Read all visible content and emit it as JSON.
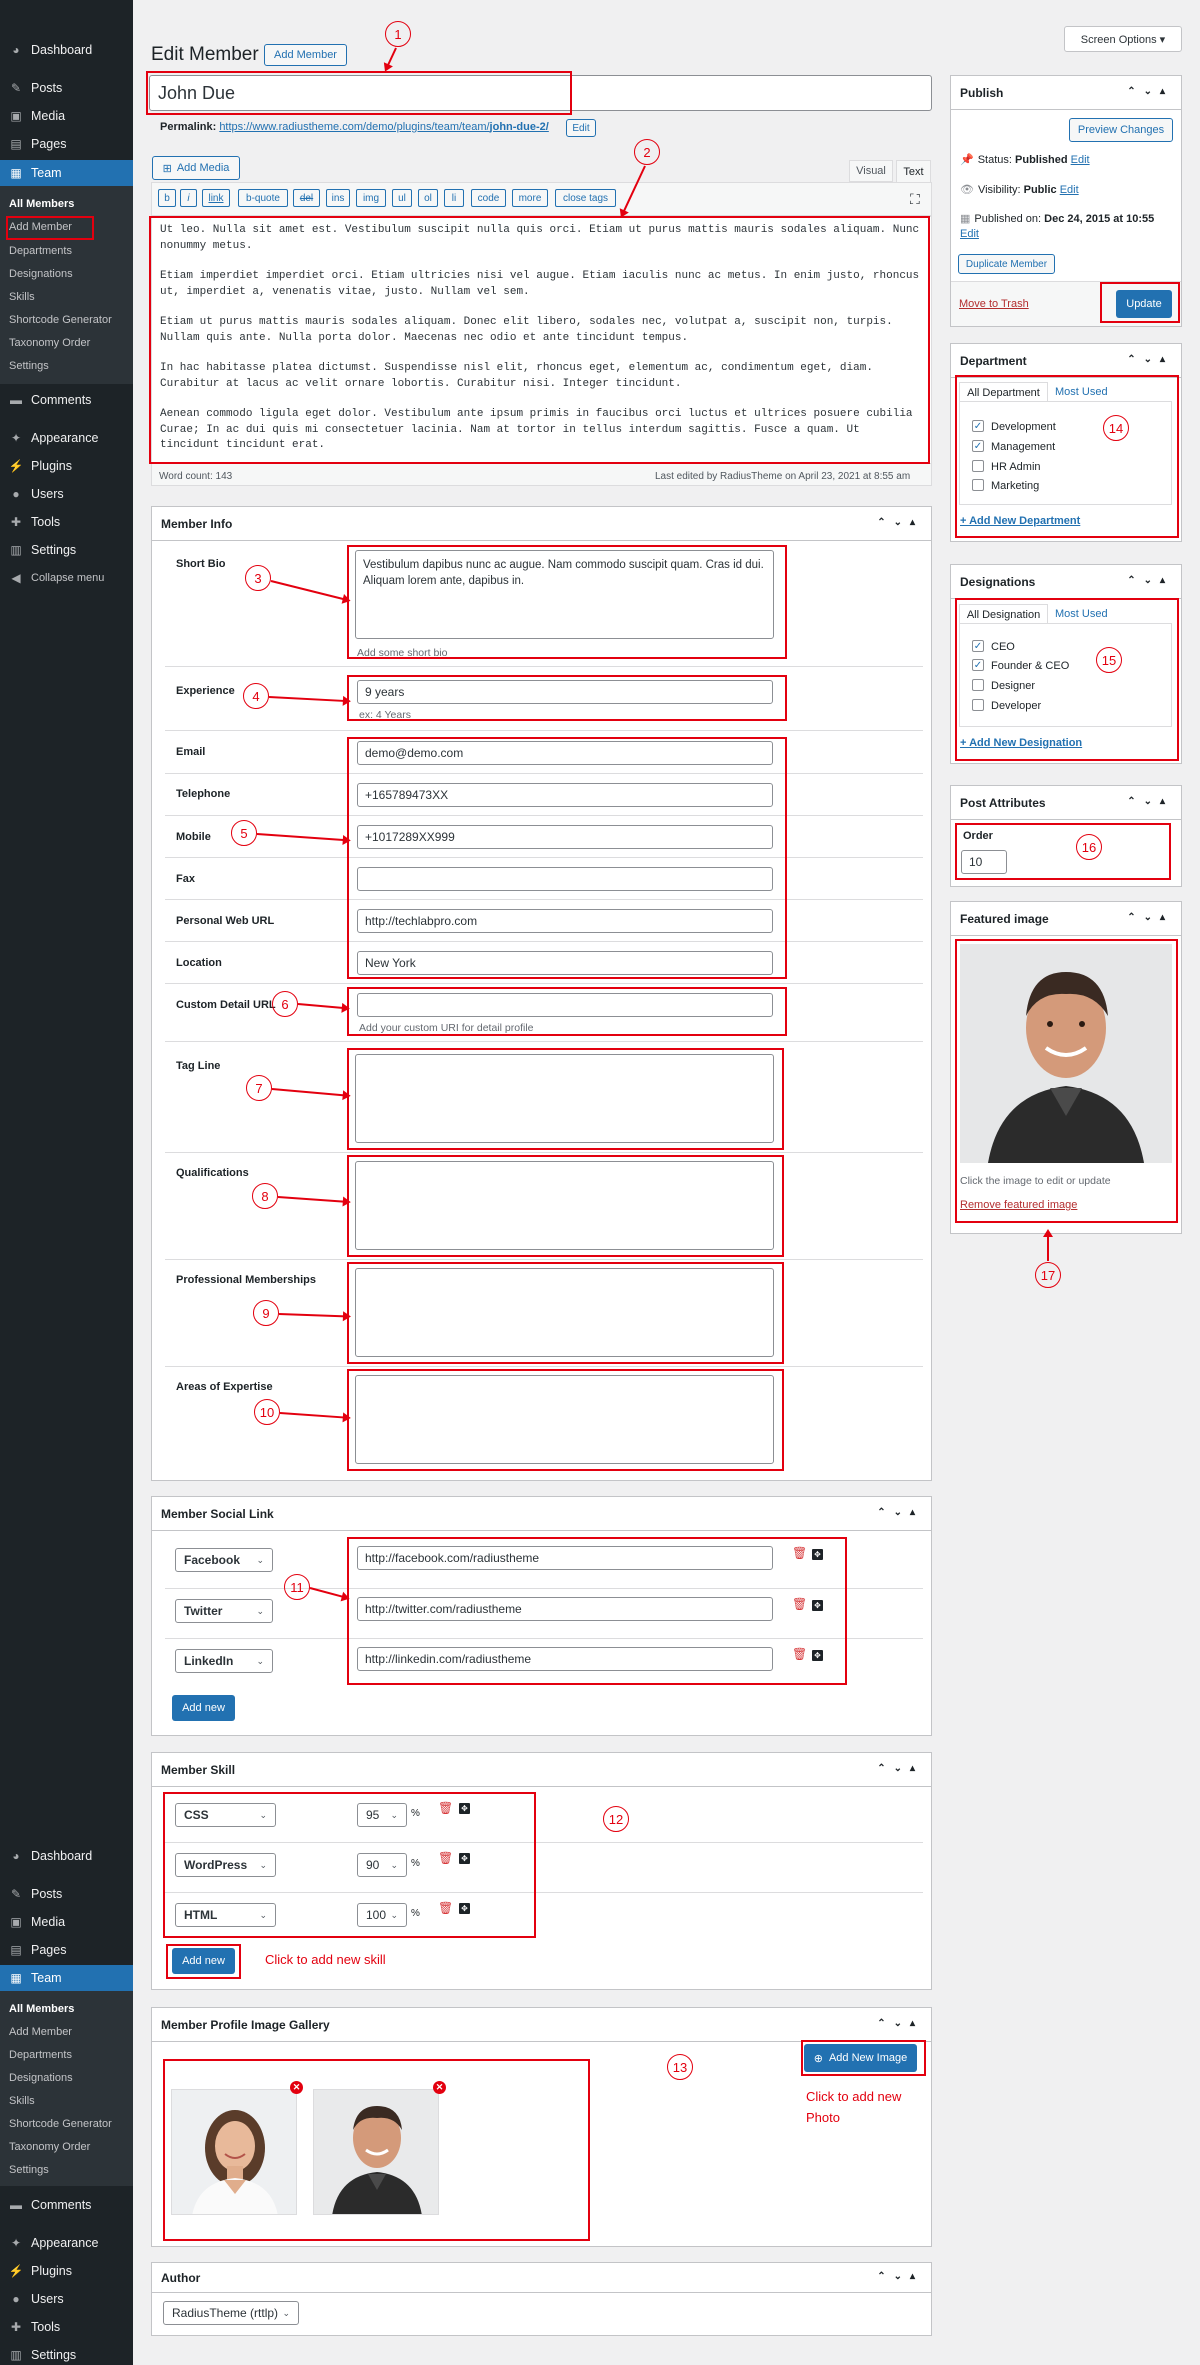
{
  "sidebar_top": [
    {
      "label": "Dashboard",
      "icon": "dashboard-icon",
      "glyph": "◕"
    },
    {
      "label": "Posts",
      "icon": "pin-icon",
      "glyph": "✎"
    },
    {
      "label": "Media",
      "icon": "media-icon",
      "glyph": "▣"
    },
    {
      "label": "Pages",
      "icon": "pages-icon",
      "glyph": "▤"
    },
    {
      "label": "Team",
      "icon": "team-icon",
      "glyph": "▦"
    }
  ],
  "sidebar_team_sub": [
    "All Members",
    "Add Member",
    "Departments",
    "Designations",
    "Skills",
    "Shortcode Generator",
    "Taxonomy Order",
    "Settings"
  ],
  "sidebar_bottom": [
    {
      "label": "Comments",
      "icon": "comments-icon",
      "glyph": "▬"
    },
    {
      "label": "Appearance",
      "icon": "appearance-icon",
      "glyph": "✦"
    },
    {
      "label": "Plugins",
      "icon": "plugins-icon",
      "glyph": "⚡"
    },
    {
      "label": "Users",
      "icon": "users-icon",
      "glyph": "●"
    },
    {
      "label": "Tools",
      "icon": "tools-icon",
      "glyph": "✚"
    },
    {
      "label": "Settings",
      "icon": "settings-icon",
      "glyph": "▥"
    },
    {
      "label": "Collapse menu",
      "icon": "collapse-icon",
      "glyph": "◀"
    }
  ],
  "sidebar_repeat_sub": [
    "All Members",
    "Add Member",
    "Departments",
    "Designations",
    "Skills",
    "Shortcode Generator",
    "Taxonomy Order",
    "Settings"
  ],
  "sidebar_repeat_bottom": [
    "Comments",
    "Appearance",
    "Plugins",
    "Users",
    "Tools",
    "Settings"
  ],
  "header": {
    "screen_options": "Screen Options ▾",
    "page_title": "Edit Member",
    "add_member": "Add Member"
  },
  "post": {
    "title": "John Due",
    "permalink_label": "Permalink:",
    "permalink_url": "https://www.radiustheme.com/demo/plugins/team/team/",
    "permalink_slug": "john-due-2/",
    "edit": "Edit",
    "add_media": "Add Media",
    "tab_visual": "Visual",
    "tab_text": "Text",
    "quicktags": [
      "b",
      "i",
      "link",
      "b-quote",
      "del",
      "ins",
      "img",
      "ul",
      "ol",
      "li",
      "code",
      "more",
      "close tags"
    ],
    "content": [
      "Ut leo. Nulla sit amet est. Vestibulum suscipit nulla quis orci. Etiam ut purus mattis mauris sodales aliquam. Nunc nonummy metus.",
      "Etiam imperdiet imperdiet orci. Etiam ultricies nisi vel augue. Etiam iaculis nunc ac metus. In enim justo, rhoncus ut, imperdiet a, venenatis vitae, justo. Nullam vel sem.",
      "Etiam ut purus mattis mauris sodales aliquam. Donec elit libero, sodales nec, volutpat a, suscipit non, turpis. Nullam quis ante. Nulla porta dolor. Maecenas nec odio et ante tincidunt tempus.",
      "In hac habitasse platea dictumst. Suspendisse nisl elit, rhoncus eget, elementum ac, condimentum eget, diam. Curabitur at lacus ac velit ornare lobortis. Curabitur nisi. Integer tincidunt.",
      "Aenean commodo ligula eget dolor. Vestibulum ante ipsum primis in faucibus orci luctus et ultrices posuere cubilia Curae; In ac dui quis mi consectetuer lacinia. Nam at tortor in tellus interdum sagittis. Fusce a quam. Ut tincidunt tincidunt erat."
    ],
    "word_count": "Word count: 143",
    "last_edited": "Last edited by RadiusTheme on April 23, 2021 at 8:55 am"
  },
  "member_info": {
    "title": "Member Info",
    "short_bio_label": "Short Bio",
    "short_bio": "Vestibulum dapibus nunc ac augue. Nam commodo suscipit quam. Cras id dui. Aliquam lorem ante, dapibus in.",
    "short_bio_hint": "Add some short bio",
    "experience_label": "Experience",
    "experience": "9 years",
    "experience_hint": "ex: 4 Years",
    "email_label": "Email",
    "email": "demo@demo.com",
    "telephone_label": "Telephone",
    "telephone": "+165789473XX",
    "mobile_label": "Mobile",
    "mobile": "+1017289XX999",
    "fax_label": "Fax",
    "fax": "",
    "web_label": "Personal Web URL",
    "web": "http://techlabpro.com",
    "location_label": "Location",
    "location": "New York",
    "custom_url_label": "Custom Detail URL",
    "custom_url": "",
    "custom_url_hint": "Add your custom URI for detail profile",
    "tagline_label": "Tag Line",
    "qualifications_label": "Qualifications",
    "memberships_label": "Professional Memberships",
    "expertise_label": "Areas of Expertise"
  },
  "social": {
    "title": "Member Social Link",
    "rows": [
      {
        "network": "Facebook",
        "url": "http://facebook.com/radiustheme"
      },
      {
        "network": "Twitter",
        "url": "http://twitter.com/radiustheme"
      },
      {
        "network": "LinkedIn",
        "url": "http://linkedin.com/radiustheme"
      }
    ],
    "add_new": "Add new"
  },
  "skill": {
    "title": "Member Skill",
    "rows": [
      {
        "skill": "CSS",
        "value": "95"
      },
      {
        "skill": "WordPress",
        "value": "90"
      },
      {
        "skill": "HTML",
        "value": "100"
      }
    ],
    "percent": "%",
    "add_new": "Add new",
    "hint": "Click to add new skill"
  },
  "gallery": {
    "title": "Member Profile Image Gallery",
    "add_new_image": "Add New Image",
    "hint_line1": "Click to add new",
    "hint_line2": "Photo"
  },
  "author": {
    "title": "Author",
    "value": "RadiusTheme (rttlp)"
  },
  "publish": {
    "title": "Publish",
    "preview": "Preview Changes",
    "status_label": "Status:",
    "status": "Published",
    "edit": "Edit",
    "visibility_label": "Visibility:",
    "visibility": "Public",
    "published_label": "Published on:",
    "published": "Dec 24, 2015 at 10:55",
    "duplicate": "Duplicate Member",
    "trash": "Move to Trash",
    "update": "Update"
  },
  "department": {
    "title": "Department",
    "tab_all": "All Department",
    "tab_most": "Most Used",
    "items": [
      {
        "label": "Development",
        "checked": true
      },
      {
        "label": "Management",
        "checked": true
      },
      {
        "label": "HR Admin",
        "checked": false
      },
      {
        "label": "Marketing",
        "checked": false
      }
    ],
    "add_new": "+ Add New Department"
  },
  "designations": {
    "title": "Designations",
    "tab_all": "All Designation",
    "tab_most": "Most Used",
    "items": [
      {
        "label": "CEO",
        "checked": true
      },
      {
        "label": "Founder & CEO",
        "checked": true
      },
      {
        "label": "Designer",
        "checked": false
      },
      {
        "label": "Developer",
        "checked": false
      }
    ],
    "add_new": "+ Add New Designation"
  },
  "post_attributes": {
    "title": "Post Attributes",
    "order_label": "Order",
    "order": "10"
  },
  "featured": {
    "title": "Featured image",
    "hint": "Click the image to edit or update",
    "remove": "Remove featured image"
  },
  "callouts": [
    "1",
    "2",
    "3",
    "4",
    "5",
    "6",
    "7",
    "8",
    "9",
    "10",
    "11",
    "12",
    "13",
    "14",
    "15",
    "16",
    "17"
  ],
  "colors": {
    "accent": "#2271b1",
    "sidebar": "#1d2327",
    "annotation": "#e3000f"
  }
}
